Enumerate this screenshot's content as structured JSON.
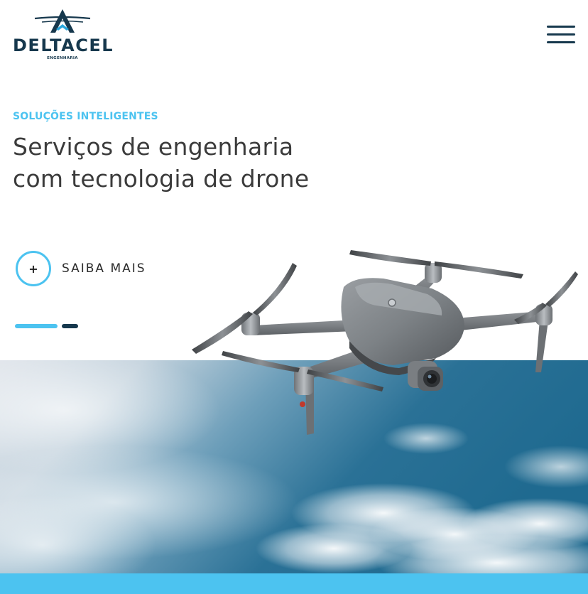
{
  "brand": {
    "name": "DELTACEL",
    "tagline": "ENGENHARIA"
  },
  "header": {
    "menu_icon": "hamburger-menu-icon"
  },
  "hero": {
    "eyebrow": "SOLUÇÕES INTELIGENTES",
    "headline_line1": "Serviços de engenharia",
    "headline_line2": "com tecnologia de drone",
    "cta_symbol": "+",
    "cta_label": "SAIBA MAIS",
    "slider_current": 1,
    "slider_total": 2
  },
  "colors": {
    "accent": "#4cc3f0",
    "brand_dark": "#16384d",
    "text": "#3b3b3b"
  }
}
